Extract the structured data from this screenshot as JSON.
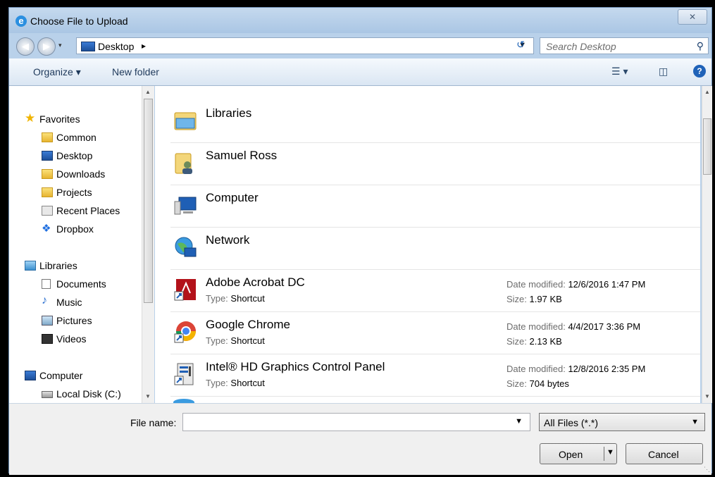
{
  "window": {
    "title": "Choose File to Upload",
    "close_label": "✕"
  },
  "address": {
    "location": "Desktop",
    "search_placeholder": "Search Desktop"
  },
  "toolbar": {
    "organize": "Organize ▾",
    "new_folder": "New folder"
  },
  "sidebar": {
    "favorites_header": "Favorites",
    "favorites": [
      "Common",
      "Desktop",
      "Downloads",
      "Projects",
      "Recent Places",
      "Dropbox"
    ],
    "libraries_header": "Libraries",
    "libraries": [
      "Documents",
      "Music",
      "Pictures",
      "Videos"
    ],
    "computer_header": "Computer",
    "computer": [
      "Local Disk (C:)"
    ]
  },
  "content": {
    "type_key": "Type:",
    "date_key": "Date modified:",
    "size_key": "Size:",
    "items": [
      {
        "name": "Libraries"
      },
      {
        "name": "Samuel Ross"
      },
      {
        "name": "Computer"
      },
      {
        "name": "Network"
      },
      {
        "name": "Adobe Acrobat DC",
        "type": "Shortcut",
        "date": "12/6/2016 1:47 PM",
        "size": "1.97 KB"
      },
      {
        "name": "Google Chrome",
        "type": "Shortcut",
        "date": "4/4/2017 3:36 PM",
        "size": "2.13 KB"
      },
      {
        "name": "Intel® HD Graphics Control Panel",
        "type": "Shortcut",
        "date": "12/8/2016 2:35 PM",
        "size": "704 bytes"
      }
    ]
  },
  "footer": {
    "file_name_label": "File name:",
    "file_name_value": "",
    "filter": "All Files (*.*)",
    "open_label": "Open",
    "cancel_label": "Cancel"
  },
  "colors": {
    "window_frame": "#b9d1ea",
    "toolbar_text": "#1e395b",
    "accent_blue": "#1f62b8"
  }
}
